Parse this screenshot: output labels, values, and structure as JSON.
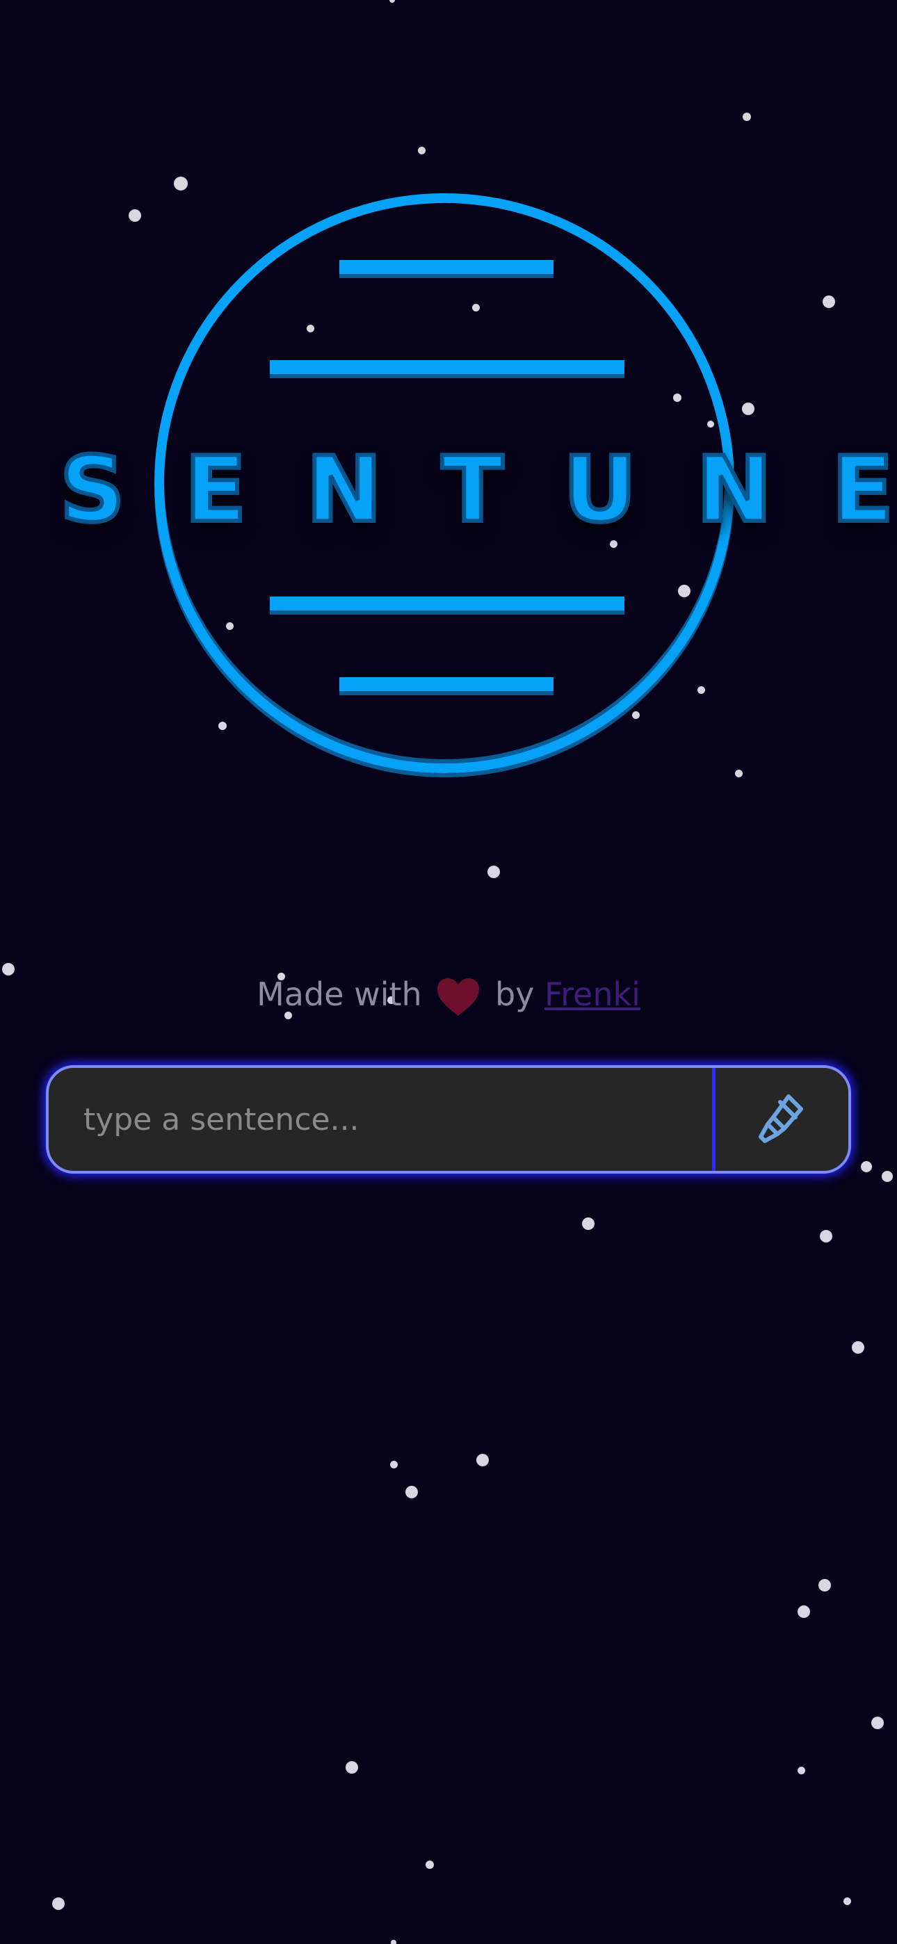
{
  "app": {
    "logo_text": "SENTUNE",
    "accent_color": "#05a2f7",
    "background_color": "#06021a"
  },
  "credit": {
    "prefix": "Made with",
    "heart_icon": "heart-icon",
    "middle": "by",
    "author": "Frenki"
  },
  "search": {
    "placeholder": "type a sentence...",
    "value": "",
    "submit_icon": "paintbrush-icon"
  }
}
